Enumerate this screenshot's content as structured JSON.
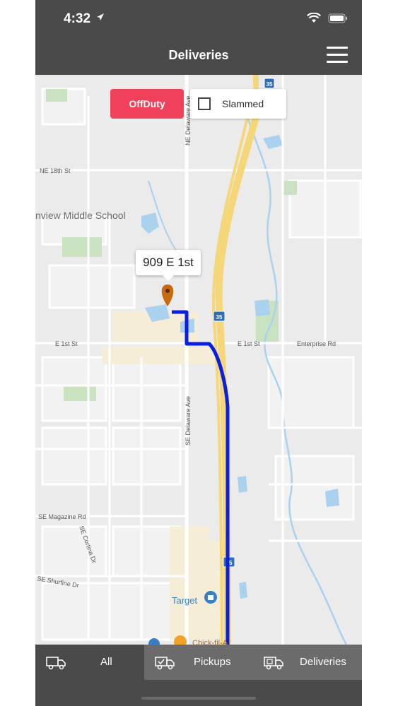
{
  "status_bar": {
    "time": "4:32"
  },
  "nav": {
    "title": "Deliveries"
  },
  "controls": {
    "offduty_label": "OffDuty",
    "slammed_label": "Slammed",
    "slammed_checked": false
  },
  "map": {
    "callout": "909 E 1st",
    "labels": {
      "ne_delaware": "NE Delaware Ave",
      "ne_18th": "NE 18th St",
      "school": "nview Middle School",
      "e_1st_w": "E 1st St",
      "e_1st_e": "E 1st St",
      "enterprise": "Enterprise Rd",
      "se_delaware": "SE Delaware Ave",
      "se_magazine": "SE Magazine Rd",
      "se_cortina": "SE Cortina Dr",
      "se_shurfine": "SE Shurfine Dr",
      "target": "Target",
      "chick": "Chick-fil-A",
      "i35_top": "35",
      "i35_mid": "35",
      "i35_bottom": "35"
    },
    "route_color": "#0a1fe0",
    "highway_color": "#f5d77a",
    "pin_color": "#c86a10"
  },
  "tabs": [
    {
      "label": "All",
      "icon": "truck-icon"
    },
    {
      "label": "Pickups",
      "icon": "truck-check-icon"
    },
    {
      "label": "Deliveries",
      "icon": "truck-box-icon"
    }
  ]
}
